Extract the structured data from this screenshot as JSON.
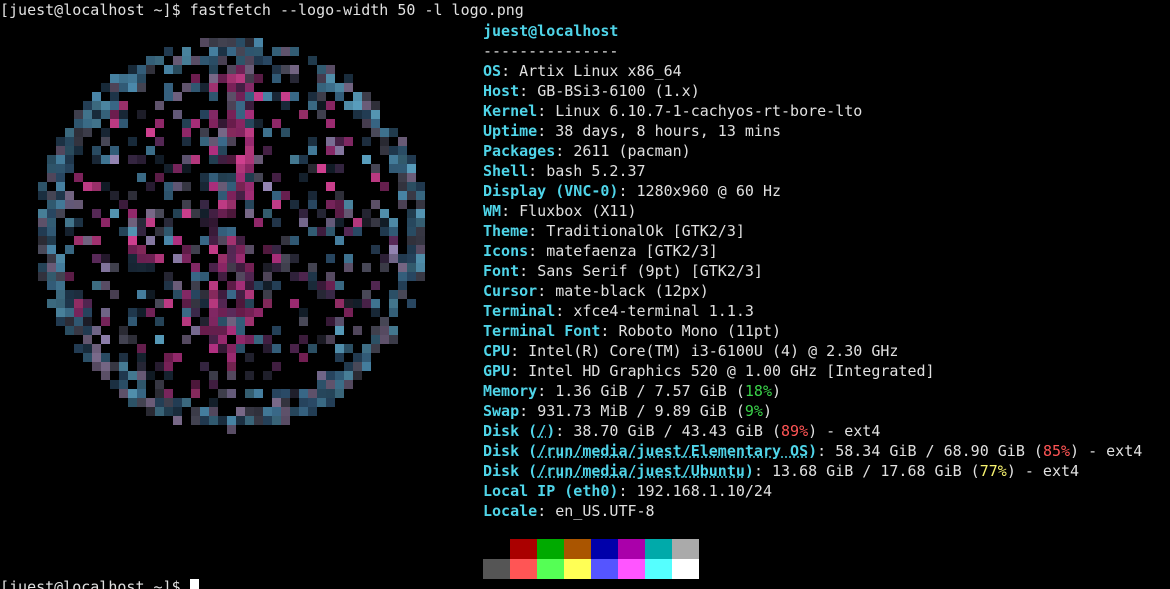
{
  "terminal": {
    "prompt_top": "[juest@localhost ~]$ fastfetch --logo-width 50 -l logo.png",
    "prompt_bottom": "[juest@localhost ~]$ "
  },
  "info": {
    "title": "juest@localhost",
    "separator": "---------------",
    "rows": [
      {
        "key": "OS",
        "val": "Artix Linux x86_64"
      },
      {
        "key": "Host",
        "val": "GB-BSi3-6100 (1.x)"
      },
      {
        "key": "Kernel",
        "val": "Linux 6.10.7-1-cachyos-rt-bore-lto"
      },
      {
        "key": "Uptime",
        "val": "38 days, 8 hours, 13 mins"
      },
      {
        "key": "Packages",
        "val": "2611 (pacman)"
      },
      {
        "key": "Shell",
        "val": "bash 5.2.37"
      },
      {
        "key": "Display (VNC-0)",
        "val": "1280x960 @ 60 Hz"
      },
      {
        "key": "WM",
        "val": "Fluxbox (X11)"
      },
      {
        "key": "Theme",
        "val": "TraditionalOk [GTK2/3]"
      },
      {
        "key": "Icons",
        "val": "matefaenza [GTK2/3]"
      },
      {
        "key": "Font",
        "val": "Sans Serif (9pt) [GTK2/3]"
      },
      {
        "key": "Cursor",
        "val": "mate-black (12px)"
      },
      {
        "key": "Terminal",
        "val": "xfce4-terminal 1.1.3"
      },
      {
        "key": "Terminal Font",
        "val": "Roboto Mono (11pt)"
      },
      {
        "key": "CPU",
        "val": "Intel(R) Core(TM) i3-6100U (4) @ 2.30 GHz"
      },
      {
        "key": "GPU",
        "val": "Intel HD Graphics 520 @ 1.00 GHz [Integrated]"
      }
    ],
    "memory": {
      "key": "Memory",
      "pre": "1.36 GiB / 7.57 GiB (",
      "pct": "18%",
      "post": ")"
    },
    "swap": {
      "key": "Swap",
      "pre": "931.73 MiB / 9.89 GiB (",
      "pct": "9%",
      "post": ")"
    },
    "disks": [
      {
        "key_pre": "Disk (",
        "mount": "/",
        "key_post": ")",
        "pre": "38.70 GiB / 43.43 GiB (",
        "pct": "89%",
        "post": ") - ext4",
        "pct_class": "pct-red"
      },
      {
        "key_pre": "Disk (",
        "mount": "/run/media/juest/Elementary OS",
        "key_post": ")",
        "pre": "58.34 GiB / 68.90 GiB (",
        "pct": "85%",
        "post": ") - ext4",
        "pct_class": "pct-red"
      },
      {
        "key_pre": "Disk (",
        "mount": "/run/media/juest/Ubuntu",
        "key_post": ")",
        "pre": "13.68 GiB / 17.68 GiB (",
        "pct": "77%",
        "post": ") - ext4",
        "pct_class": "pct-yellow"
      }
    ],
    "local_ip": {
      "key": "Local IP (eth0)",
      "val": "192.168.1.10/24"
    },
    "locale": {
      "key": "Locale",
      "val": "en_US.UTF-8"
    }
  },
  "palette": {
    "row1": [
      "#000000",
      "#aa0000",
      "#00aa00",
      "#aa5500",
      "#0000aa",
      "#aa00aa",
      "#00aaaa",
      "#aaaaaa"
    ],
    "row2": [
      "#555555",
      "#ff5555",
      "#55ff55",
      "#ffff55",
      "#5555ff",
      "#ff55ff",
      "#55ffff",
      "#ffffff"
    ]
  },
  "logo": {
    "icon": "circular-pixel-logo-icon"
  }
}
